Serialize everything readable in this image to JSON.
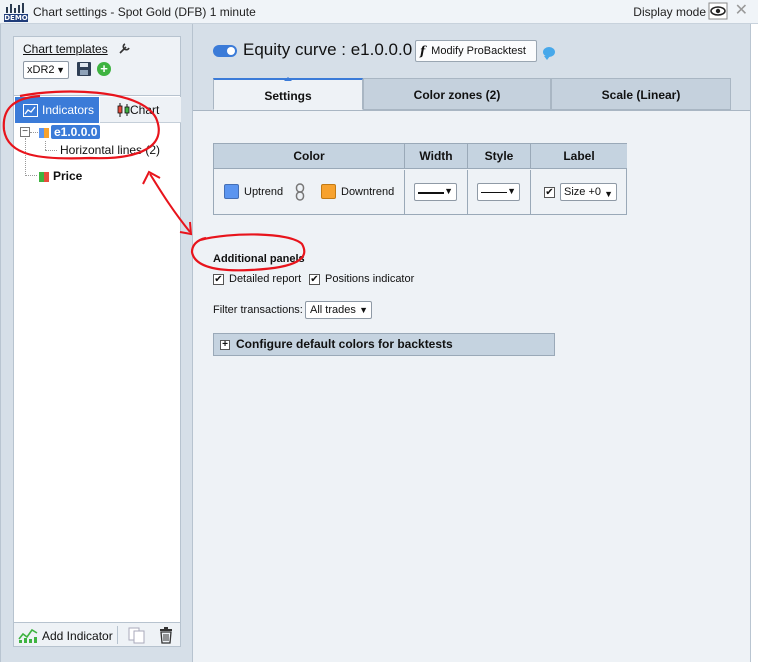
{
  "titlebar": {
    "demo_badge": "DEMO",
    "title": "Chart settings - Spot Gold (DFB) 1 minute",
    "display_mode": "Display mode",
    "close": "✕"
  },
  "templates": {
    "title": "Chart templates",
    "selected": "xDR2",
    "add_symbol": "+"
  },
  "left_tabs": {
    "indicators": "Indicators",
    "chart": "Chart"
  },
  "tree": {
    "collapse_symbol": "−",
    "items": [
      {
        "label": "e1.0.0.0"
      },
      {
        "label": "Horizontal lines (2)"
      },
      {
        "label": "Price"
      }
    ]
  },
  "left_footer": {
    "add_indicator": "Add Indicator"
  },
  "header": {
    "title": "Equity curve : e1.0.0.0",
    "modify_fx": "f",
    "modify_button": "Modify ProBacktest"
  },
  "tabs": [
    {
      "label": "Settings",
      "active": true
    },
    {
      "label": "Color zones (2)",
      "active": false
    },
    {
      "label": "Scale (Linear)",
      "active": false
    }
  ],
  "color_table": {
    "headers": [
      "Color",
      "Width",
      "Style",
      "Label"
    ],
    "uptrend_label": "Uptrend",
    "uptrend_color": "#5b95f0",
    "downtrend_label": "Downtrend",
    "downtrend_color": "#f7a22e",
    "label_checked": true,
    "label_size": "Size +0"
  },
  "additional_panels": {
    "title": "Additional panels",
    "detailed_report": "Detailed report",
    "detailed_report_checked": true,
    "positions_indicator": "Positions indicator",
    "positions_indicator_checked": true
  },
  "filter": {
    "label": "Filter transactions:",
    "selected": "All trades"
  },
  "config_bar": {
    "plus": "+",
    "label": "Configure default colors for backtests"
  },
  "colors": {
    "accent": "#3b7bd8",
    "annotation": "#e8141c"
  }
}
